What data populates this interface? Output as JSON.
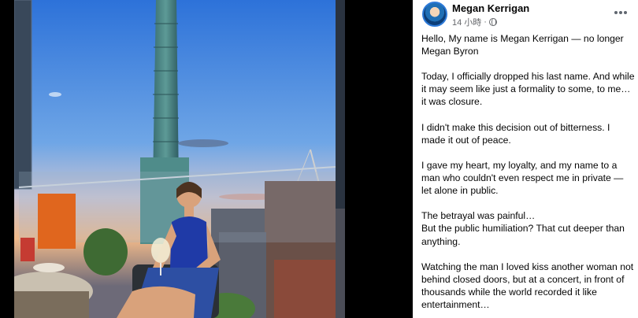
{
  "post": {
    "author": "Megan Kerrigan",
    "timestamp": "14 小時",
    "paragraphs": [
      "Hello, My name is Megan Kerrigan — no longer Megan Byron",
      "Today, I officially dropped his last name. And while it may seem like just a formality to some, to me… it was closure.",
      "I didn't make this decision out of bitterness. I made it out of peace.",
      "I gave my heart, my loyalty, and my name to a man who couldn't even respect me in private — let alone in public.",
      "The betrayal was painful…\nBut the public humiliation? That cut deeper than anything.",
      "Watching the man I loved kiss another woman not behind closed doors, but at a concert, in front of thousands while the world recorded it like entertainment…"
    ]
  },
  "icons": {
    "audience": "globe-icon",
    "more": "more-options-icon",
    "avatar": "profile-avatar"
  },
  "colors": {
    "author_text": "#050505",
    "meta_text": "#65676b",
    "panel_bg": "#ffffff",
    "backdrop": "#000000"
  }
}
